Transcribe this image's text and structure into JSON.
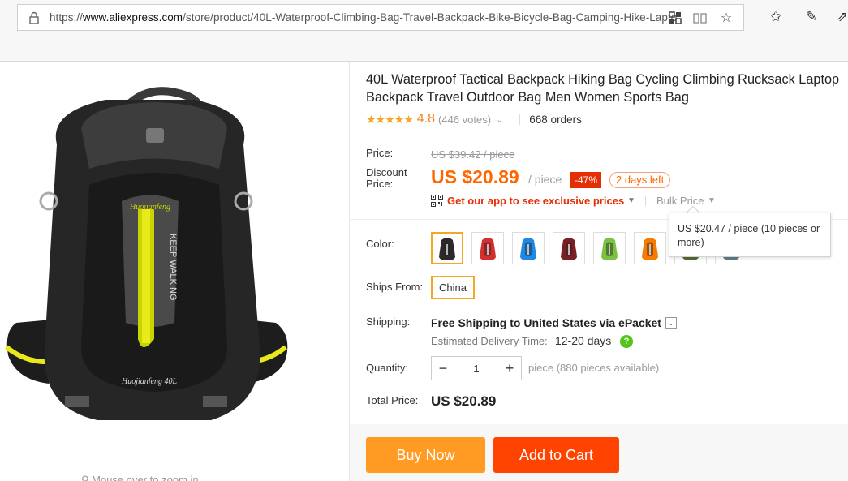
{
  "browser": {
    "url_prefix": "https://",
    "url_domain": "www.aliexpress.com",
    "url_path": "/store/product/40L-Waterproof-Climbing-Bag-Travel-Backpack-Bike-Bicycle-Bag-Camping-Hike-Laptop"
  },
  "product": {
    "title": "40L Waterproof Tactical Backpack Hiking Bag Cycling Climbing Rucksack Laptop Backpack Travel Outdoor Bag Men Women Sports Bag",
    "stars": "★★★★★",
    "rating": "4.8",
    "votes": "(446 votes)",
    "orders": "668 orders",
    "zoom_hint": "Mouse over to zoom in",
    "image_brand_text": "KEEP WALKING",
    "image_logo_text": "Huojianfeng",
    "image_model_text": "Huojianfeng 40L"
  },
  "price": {
    "price_label": "Price:",
    "original": "US $39.42 / piece",
    "discount_label_line1": "Discount",
    "discount_label_line2": "Price:",
    "discounted": "US $20.89",
    "per_piece": "/ piece",
    "discount_badge": "-47%",
    "days_left": "2 days left",
    "app_link": "Get our app to see exclusive prices",
    "bulk_label": "Bulk Price",
    "bulk_tooltip": "US $20.47 / piece (10 pieces or more)"
  },
  "options": {
    "color_label": "Color:",
    "colors": [
      {
        "name": "black",
        "hex": "#2a2a2a"
      },
      {
        "name": "red",
        "hex": "#d32f2f"
      },
      {
        "name": "blue",
        "hex": "#1e88e5"
      },
      {
        "name": "dark-red",
        "hex": "#7b1f24"
      },
      {
        "name": "green",
        "hex": "#7cc242"
      },
      {
        "name": "orange",
        "hex": "#f57c00"
      },
      {
        "name": "army-green",
        "hex": "#556b2f"
      },
      {
        "name": "grey",
        "hex": "#607d8b"
      }
    ],
    "ships_from_label": "Ships From:",
    "ships_from_value": "China"
  },
  "shipping": {
    "label": "Shipping:",
    "free_text": "Free Shipping to United States via ePacket",
    "est_label": "Estimated Delivery Time:",
    "est_days": "12-20 days"
  },
  "quantity": {
    "label": "Quantity:",
    "minus": "−",
    "value": "1",
    "plus": "+",
    "available": "piece (880 pieces available)"
  },
  "total": {
    "label": "Total Price:",
    "value": "US $20.89"
  },
  "actions": {
    "buy_now": "Buy Now",
    "add_to_cart": "Add to Cart"
  },
  "colors": {
    "accent_orange": "#ff6600",
    "buy_now_bg": "#ff9a23",
    "add_cart_bg": "#ff4300",
    "badge_red": "#e62e04"
  }
}
